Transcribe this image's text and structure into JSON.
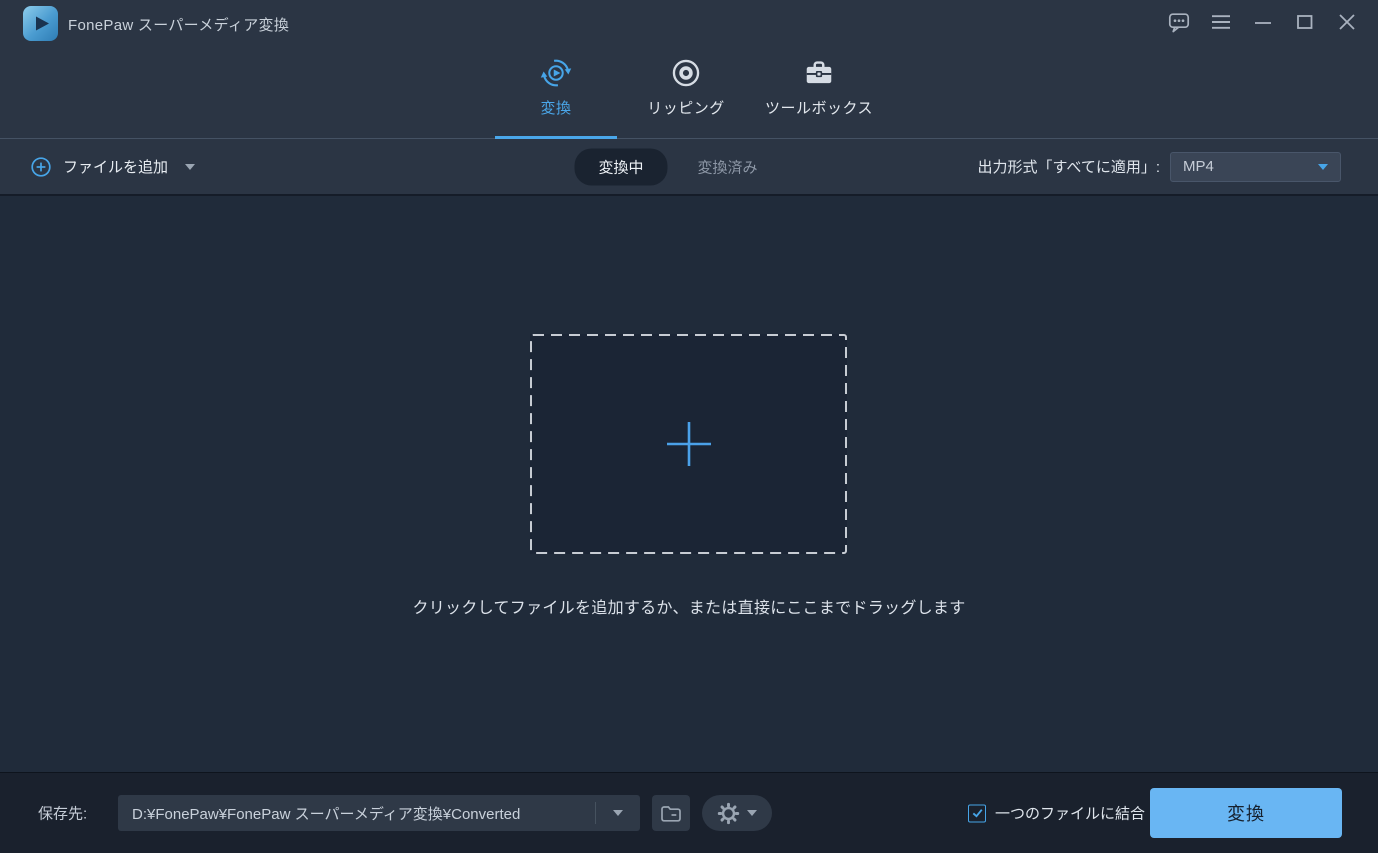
{
  "window": {
    "title": "FonePaw スーパーメディア変換"
  },
  "colors": {
    "accent": "#47a5e8",
    "convert_button": "#69b6f3",
    "header_bg": "#2b3544",
    "main_bg": "#202b3a",
    "bottom_bg": "#1a212d"
  },
  "tabs": [
    {
      "label": "変換",
      "active": true
    },
    {
      "label": "リッピング",
      "active": false
    },
    {
      "label": "ツールボックス",
      "active": false
    }
  ],
  "toolbar": {
    "add_files_label": "ファイルを追加",
    "segment_converting": "変換中",
    "segment_converted": "変換済み",
    "output_format_label": "出力形式「すべてに適用」:",
    "output_format_value": "MP4"
  },
  "dropzone": {
    "hint": "クリックしてファイルを追加するか、または直接にここまでドラッグします"
  },
  "bottom": {
    "destination_label": "保存先:",
    "destination_path": "D:¥FonePaw¥FonePaw スーパーメディア変換¥Converted",
    "merge_label": "一つのファイルに結合",
    "merge_checked": true,
    "convert_label": "変換"
  },
  "icons": {
    "app-logo-icon": "blue rounded square with play triangle",
    "feedback-icon": "speech bubble with ellipsis",
    "menu-icon": "hamburger",
    "minimize-icon": "minus line",
    "maximize-icon": "square outline",
    "close-icon": "x cross",
    "convert-icon": "circular refresh arrows around play circle",
    "ripping-icon": "optical disc rings",
    "toolbox-icon": "briefcase",
    "plus-circle-icon": "circled plus",
    "add-file-plus-icon": "large thin plus",
    "chevron-down-icon": "small down triangle",
    "folder-icon": "folder outline",
    "gear-icon": "gear outline",
    "check-icon": "checkmark"
  }
}
